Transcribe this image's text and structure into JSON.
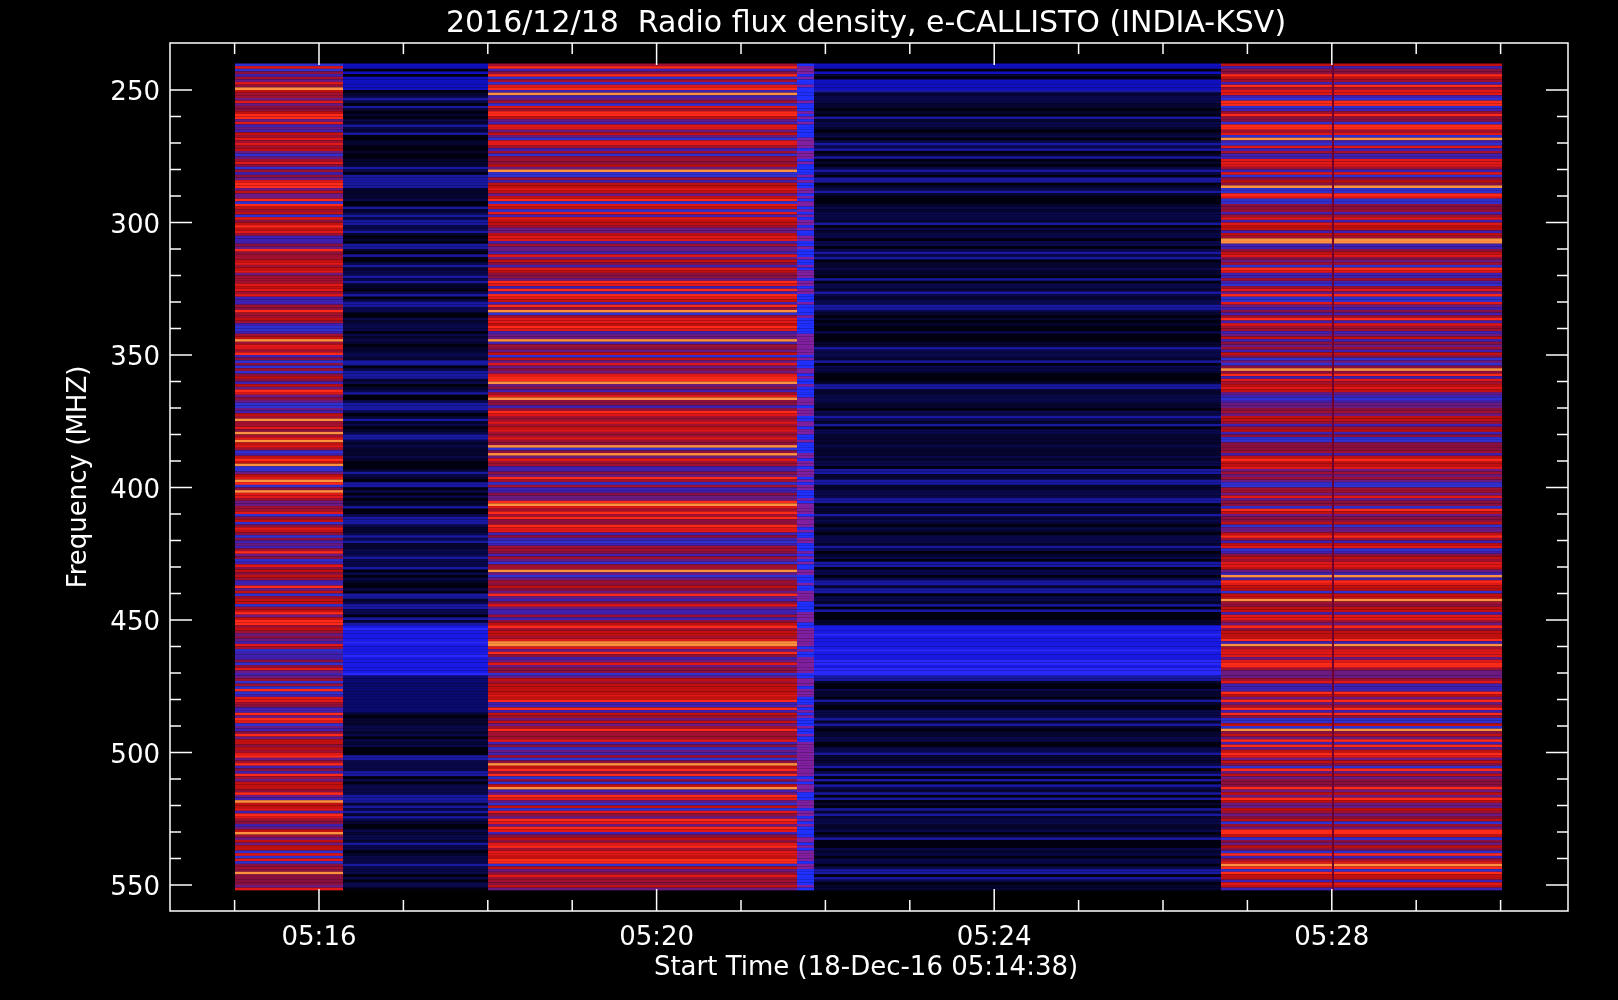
{
  "title": "2016/12/18  Radio flux density, e-CALLISTO (INDIA-KSV)",
  "y_axis": {
    "label": "Frequency (MHZ)",
    "ticks": [
      "250",
      "300",
      "350",
      "400",
      "450",
      "500",
      "550"
    ]
  },
  "x_axis": {
    "label": "Start Time (18-Dec-16 05:14:38)",
    "ticks": [
      "05:16",
      "05:20",
      "05:24",
      "05:28"
    ]
  }
}
